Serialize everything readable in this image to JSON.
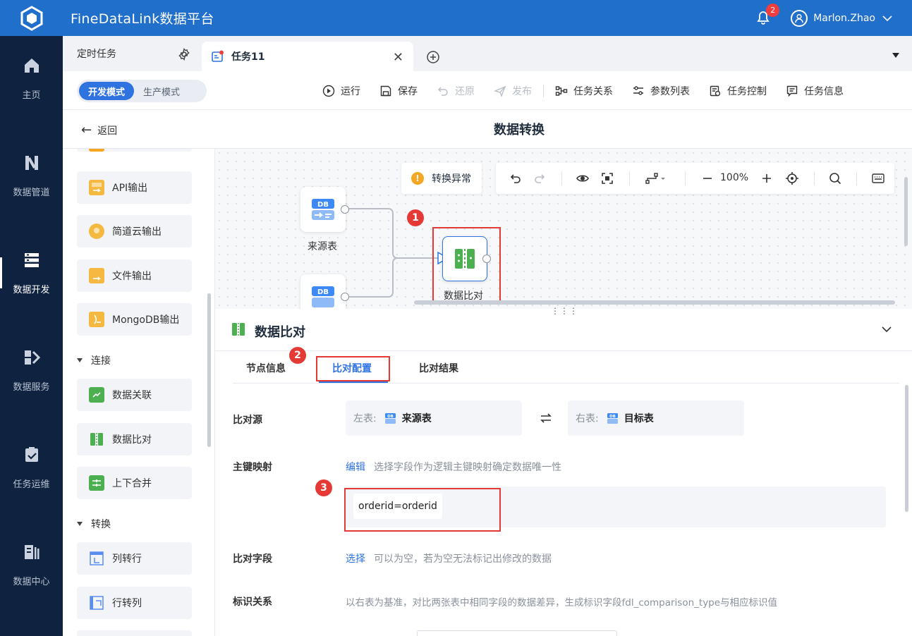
{
  "app": {
    "title": "FineDataLink数据平台"
  },
  "header": {
    "notification_count": "2",
    "user_name": "Marlon.Zhao"
  },
  "leftnav": {
    "items": [
      {
        "label": "主页",
        "icon": "home-icon",
        "active": false
      },
      {
        "label": "数据管道",
        "icon": "pipeline-icon",
        "active": false
      },
      {
        "label": "数据开发",
        "icon": "dev-icon",
        "active": true
      },
      {
        "label": "数据服务",
        "icon": "service-icon",
        "active": false
      },
      {
        "label": "任务运维",
        "icon": "ops-icon",
        "active": false
      },
      {
        "label": "数据中心",
        "icon": "datacenter-icon",
        "active": false
      }
    ]
  },
  "tabs": {
    "fixed_tab": "定时任务",
    "active_tab": "任务11"
  },
  "toolbar": {
    "modes": [
      "开发模式",
      "生产模式"
    ],
    "active_mode": "开发模式",
    "actions": [
      {
        "label": "运行",
        "disabled": false
      },
      {
        "label": "保存",
        "disabled": false
      },
      {
        "label": "还原",
        "disabled": true
      },
      {
        "label": "发布",
        "disabled": true
      },
      {
        "label": "任务关系",
        "disabled": false
      },
      {
        "label": "参数列表",
        "disabled": false
      },
      {
        "label": "任务控制",
        "disabled": false
      },
      {
        "label": "任务信息",
        "disabled": false
      }
    ]
  },
  "subheader": {
    "back": "返回",
    "title": "数据转换"
  },
  "sidepanel": {
    "outputs": [
      "API输出",
      "简道云输出",
      "文件输出",
      "MongoDB输出"
    ],
    "group_connect": "连接",
    "connect_items": [
      "数据关联",
      "数据比对",
      "上下合并"
    ],
    "group_transform": "转换",
    "transform_items": [
      "列转行",
      "行转列"
    ]
  },
  "canvas": {
    "status": "转换异常",
    "zoom": "100%",
    "nodes": {
      "source": "来源表",
      "compare": "数据比对"
    },
    "annotations": [
      "1",
      "2",
      "3"
    ]
  },
  "props": {
    "title": "数据比对",
    "tabs": [
      "节点信息",
      "比对配置",
      "比对结果"
    ],
    "active_tab": "比对配置",
    "compare_source": {
      "label": "比对源",
      "left_label": "左表:",
      "left_value": "来源表",
      "right_label": "右表:",
      "right_value": "目标表"
    },
    "key_mapping": {
      "label": "主键映射",
      "edit": "编辑",
      "hint": "选择字段作为逻辑主键映射确定数据唯一性",
      "mapping": "orderid=orderid"
    },
    "compare_fields": {
      "label": "比对字段",
      "select": "选择",
      "hint": "可以为空，若为空无法标记出修改的数据"
    },
    "mark_relation": {
      "label": "标识关系",
      "hint": "以右表为基准，对比两张表中相同字段的数据差异，生成标识字段fdl_comparison_type与相应标识值"
    }
  },
  "colors": {
    "primary": "#2e73e0",
    "topbar": "#1f6fcb",
    "nav": "#0f2240",
    "highlight": "#e53935"
  }
}
